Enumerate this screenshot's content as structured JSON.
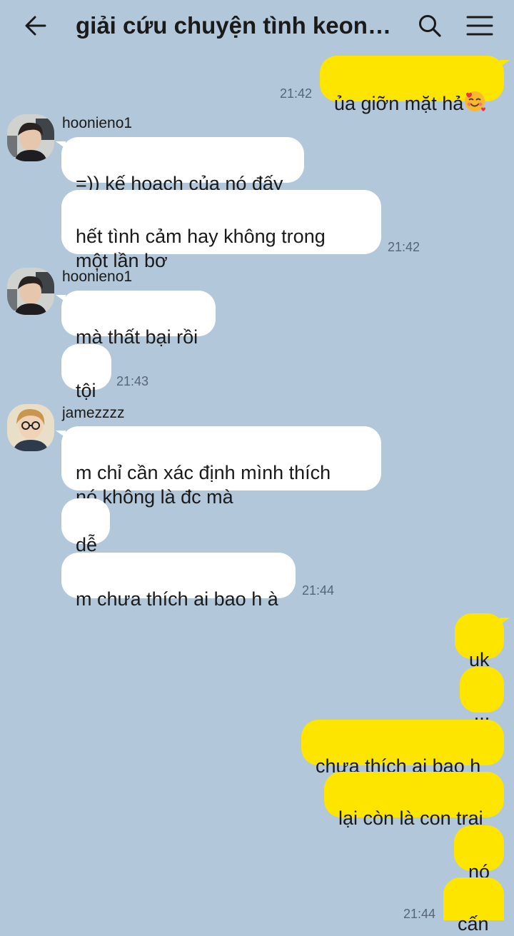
{
  "header": {
    "title": "giải cứu chuyện tình keonh...",
    "back_icon": "arrow-left-icon",
    "search_icon": "search-icon",
    "menu_icon": "hamburger-menu-icon"
  },
  "messages": {
    "m1": {
      "text": "ủa giỡn mặt hả",
      "emoji": "smiling-face-with-hearts-icon",
      "time": "21:42"
    },
    "g1": {
      "sender": "hoonieno1",
      "m1": "=)) kế hoạch của nó đấy",
      "m2": "hết tình cảm hay không trong\nmột lần bơ",
      "time": "21:42"
    },
    "g2": {
      "sender": "hoonieno1",
      "m1": "mà thất bại rồi",
      "m2": "tội",
      "time": "21:43"
    },
    "g3": {
      "sender": "jamezzzz",
      "m1": "m chỉ cần xác định mình thích\nnó không là đc mà",
      "m2": "dễ",
      "m3": "m chưa thích ai bao h à",
      "time": "21:44"
    },
    "out": {
      "m1": "uk",
      "m2": "...",
      "m3": "chưa thích ai bao h",
      "m4": "lại còn là con trai",
      "m5": "nó",
      "m6": "cấn",
      "time": "21:44"
    }
  },
  "colors": {
    "background": "#b2c7da",
    "outgoing_bubble": "#fee500",
    "incoming_bubble": "#ffffff"
  }
}
